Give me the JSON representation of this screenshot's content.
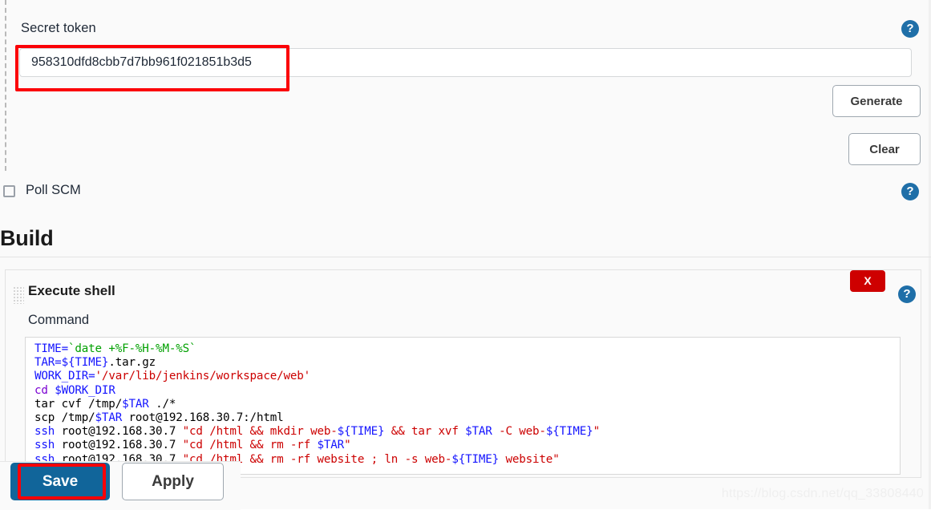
{
  "secret_token": {
    "label": "Secret token",
    "value": "958310dfd8cbb7d7bb961f021851b3d5",
    "placeholder": "",
    "help_icon": "?",
    "generate_label": "Generate",
    "clear_label": "Clear"
  },
  "poll_scm": {
    "label": "Poll SCM",
    "checked": false,
    "help_icon": "?"
  },
  "build": {
    "heading": "Build",
    "step_title": "Execute shell",
    "command_label": "Command",
    "delete_label": "X",
    "help_icon": "?",
    "drag_handle_icon": "drag-dots-icon",
    "command_lines": [
      [
        {
          "t": "TIME=",
          "c": "var"
        },
        {
          "t": "`date +%F-%H-%M-%S`",
          "c": "green"
        }
      ],
      [
        {
          "t": "TAR=",
          "c": "var"
        },
        {
          "t": "${TIME}",
          "c": "var"
        },
        {
          "t": ".tar.gz",
          "c": "plain"
        }
      ],
      [
        {
          "t": "WORK_DIR=",
          "c": "var"
        },
        {
          "t": "'/var/lib/jenkins/workspace/web'",
          "c": "str"
        }
      ],
      [
        {
          "t": "cd ",
          "c": "cmd"
        },
        {
          "t": "$WORK_DIR",
          "c": "var"
        }
      ],
      [
        {
          "t": "tar cvf /tmp/",
          "c": "plain"
        },
        {
          "t": "$TAR",
          "c": "var"
        },
        {
          "t": " ./*",
          "c": "plain"
        }
      ],
      [
        {
          "t": "scp /tmp/",
          "c": "plain"
        },
        {
          "t": "$TAR",
          "c": "var"
        },
        {
          "t": " root@192.168.30.7:/html",
          "c": "plain"
        }
      ],
      [
        {
          "t": "ssh ",
          "c": "var"
        },
        {
          "t": "root@192.168.30.7 ",
          "c": "plain"
        },
        {
          "t": "\"cd /html && mkdir web-",
          "c": "str"
        },
        {
          "t": "${TIME}",
          "c": "var"
        },
        {
          "t": " && tar xvf ",
          "c": "str"
        },
        {
          "t": "$TAR",
          "c": "var"
        },
        {
          "t": " -C web-",
          "c": "str"
        },
        {
          "t": "${TIME}",
          "c": "var"
        },
        {
          "t": "\"",
          "c": "str"
        }
      ],
      [
        {
          "t": "ssh ",
          "c": "var"
        },
        {
          "t": "root@192.168.30.7 ",
          "c": "plain"
        },
        {
          "t": "\"cd /html && rm -rf ",
          "c": "str"
        },
        {
          "t": "$TAR",
          "c": "var"
        },
        {
          "t": "\"",
          "c": "str"
        }
      ],
      [
        {
          "t": "ssh ",
          "c": "var"
        },
        {
          "t": "root@192.168.30.7 ",
          "c": "plain"
        },
        {
          "t": "\"cd /html && rm -rf website ; ln -s web-",
          "c": "str"
        },
        {
          "t": "${TIME}",
          "c": "var"
        },
        {
          "t": " website\"",
          "c": "str"
        }
      ]
    ]
  },
  "actions": {
    "save_label": "Save",
    "apply_label": "Apply"
  },
  "watermark": "https://blog.csdn.net/qq_33808440",
  "colors": {
    "accent_blue": "#11659a",
    "annotation_red": "#fb0007",
    "delete_red": "#ce0000",
    "help_blue": "#1f6fa8",
    "code_variable": "#1414ff",
    "code_string": "#cc0000",
    "code_subshell": "#00a000",
    "code_builtin": "#7a00d2"
  }
}
